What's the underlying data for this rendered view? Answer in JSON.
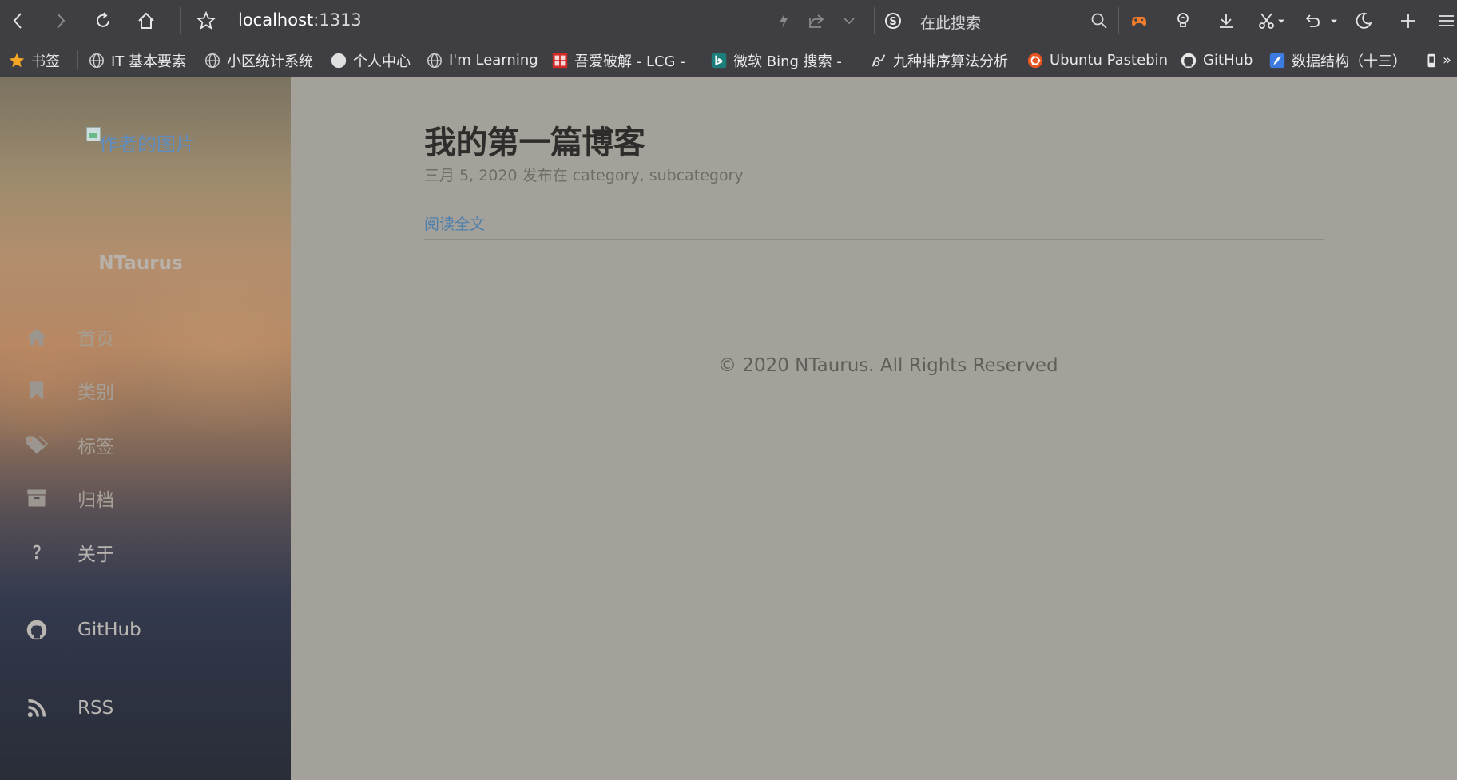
{
  "browser": {
    "url_host": "localhost",
    "url_port": ":1313",
    "search_placeholder": "在此搜索",
    "colors": {
      "toolbar_bg": "#3f3f43",
      "game_icon": "#f07c2c"
    },
    "toolbar_icons": [
      "back-icon",
      "forward-icon",
      "reload-icon",
      "home-icon",
      "star-icon",
      "lightning-icon",
      "share-icon",
      "chevron-down-icon",
      "search-engine-icon",
      "search-icon",
      "game-icon",
      "bulb-icon",
      "download-icon",
      "scissors-icon",
      "undo-icon",
      "moon-icon",
      "plus-icon",
      "menu-icon"
    ]
  },
  "bookmarks": {
    "items": [
      {
        "label": "书签",
        "icon": "star-icon"
      },
      {
        "label": "IT 基本要素",
        "icon": "globe-icon"
      },
      {
        "label": "小区统计系统",
        "icon": "globe-icon"
      },
      {
        "label": "个人中心",
        "icon": "circle-icon"
      },
      {
        "label": "I'm Learning",
        "icon": "globe-icon"
      },
      {
        "label": "吾爱破解 - LCG -",
        "icon": "site-icon"
      },
      {
        "label": "微软 Bing 搜索 -",
        "icon": "bing-icon"
      },
      {
        "label": "九种排序算法分析",
        "icon": "site-icon"
      },
      {
        "label": "Ubuntu Pastebin",
        "icon": "ubuntu-icon"
      },
      {
        "label": "GitHub",
        "icon": "github-icon"
      },
      {
        "label": "数据结构（十三）",
        "icon": "feather-icon"
      }
    ],
    "more": "»"
  },
  "sidebar": {
    "avatar_alt": "作者的图片",
    "site_name": "NTaurus",
    "nav": [
      {
        "label": "首页",
        "icon": "home-icon"
      },
      {
        "label": "类别",
        "icon": "bookmark-icon"
      },
      {
        "label": "标签",
        "icon": "tags-icon"
      },
      {
        "label": "归档",
        "icon": "archive-icon"
      },
      {
        "label": "关于",
        "icon": "question-icon"
      },
      {
        "label": "GitHub",
        "icon": "github-icon"
      },
      {
        "label": "RSS",
        "icon": "rss-icon"
      }
    ]
  },
  "post": {
    "title": "我的第一篇博客",
    "meta": "三月 5, 2020 发布在 category, subcategory",
    "read_more": "阅读全文"
  },
  "footer": {
    "text": "© 2020 NTaurus. All Rights Reserved"
  }
}
